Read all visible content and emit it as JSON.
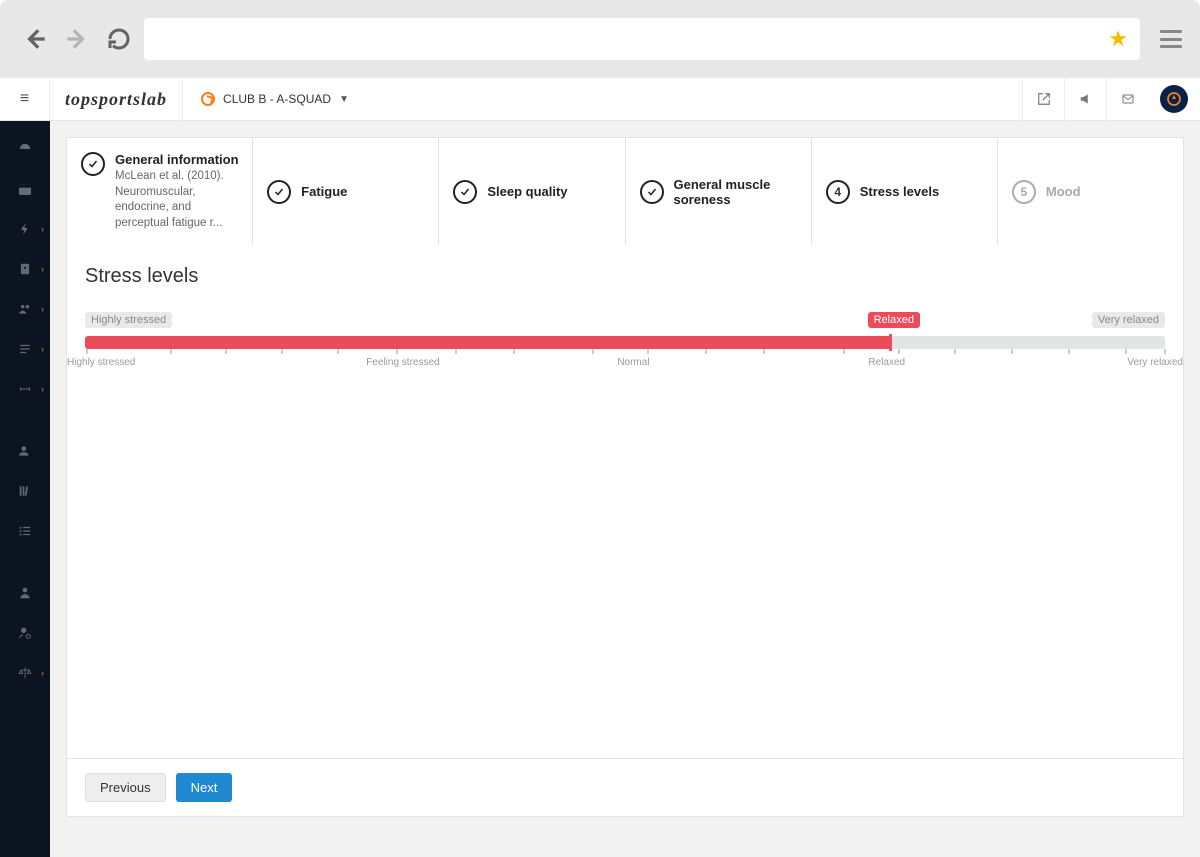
{
  "browser": {
    "url": ""
  },
  "topbar": {
    "logo": "topsportslab",
    "club_label": "CLUB B - A-SQUAD"
  },
  "steps": [
    {
      "title": "General information",
      "subtitle": "McLean et al. (2010). Neuromuscular, endocrine, and perceptual fatigue r...",
      "status": "done"
    },
    {
      "title": "Fatigue",
      "status": "done"
    },
    {
      "title": "Sleep quality",
      "status": "done"
    },
    {
      "title": "General muscle soreness",
      "status": "done"
    },
    {
      "title": "Stress levels",
      "status": "current",
      "number": "4"
    },
    {
      "title": "Mood",
      "status": "pending",
      "number": "5"
    }
  ],
  "section": {
    "title": "Stress levels",
    "min_label": "Highly stressed",
    "max_label": "Very relaxed",
    "value_label": "Relaxed",
    "value_percent": 74.5,
    "ticks": [
      {
        "pos": 1.7,
        "label": "Highly stressed"
      },
      {
        "pos": 9.2
      },
      {
        "pos": 14.2
      },
      {
        "pos": 19.2
      },
      {
        "pos": 24.2
      },
      {
        "pos": 29.5,
        "label": "Feeling stressed"
      },
      {
        "pos": 34.8
      },
      {
        "pos": 40.0
      },
      {
        "pos": 47.0
      },
      {
        "pos": 52.0,
        "label": "Normal"
      },
      {
        "pos": 57.2
      },
      {
        "pos": 62.4
      },
      {
        "pos": 69.5
      },
      {
        "pos": 74.5,
        "label": "Relaxed"
      },
      {
        "pos": 79.5
      },
      {
        "pos": 84.6
      },
      {
        "pos": 89.7
      },
      {
        "pos": 94.8
      },
      {
        "pos": 98.3,
        "label": "Very relaxed"
      }
    ]
  },
  "footer": {
    "prev": "Previous",
    "next": "Next"
  }
}
